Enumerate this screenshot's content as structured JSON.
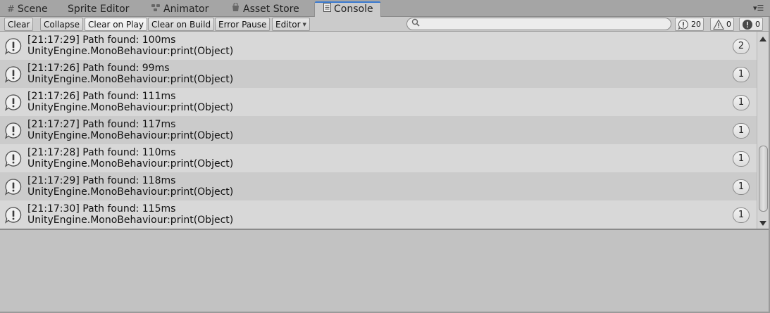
{
  "tabs": [
    {
      "label": "Scene",
      "icon": "grid-icon",
      "glyph": "#"
    },
    {
      "label": "Sprite Editor",
      "icon": "",
      "glyph": ""
    },
    {
      "label": "Animator",
      "icon": "animator-icon",
      "glyph": "⛭"
    },
    {
      "label": "Asset Store",
      "icon": "store-icon",
      "glyph": "🛍"
    },
    {
      "label": "Console",
      "icon": "console-icon",
      "glyph": "▤",
      "active": true
    }
  ],
  "toolbar": {
    "clear_label": "Clear",
    "collapse_label": "Collapse",
    "clear_on_play_label": "Clear on Play",
    "clear_on_build_label": "Clear on Build",
    "error_pause_label": "Error Pause",
    "editor_label": "Editor",
    "search_placeholder": "",
    "search_value": "",
    "log_count": "20",
    "warning_count": "0",
    "error_count": "0"
  },
  "colors": {
    "accent": "#3a7ad0",
    "row_odd": "#d8d8d8",
    "row_even": "#cbcbcb"
  },
  "log_entries": [
    {
      "message": "[21:17:29] Path found: 100ms",
      "source": "UnityEngine.MonoBehaviour:print(Object)",
      "count": "2"
    },
    {
      "message": "[21:17:26] Path found: 99ms",
      "source": "UnityEngine.MonoBehaviour:print(Object)",
      "count": "1"
    },
    {
      "message": "[21:17:26] Path found: 111ms",
      "source": "UnityEngine.MonoBehaviour:print(Object)",
      "count": "1"
    },
    {
      "message": "[21:17:27] Path found: 117ms",
      "source": "UnityEngine.MonoBehaviour:print(Object)",
      "count": "1"
    },
    {
      "message": "[21:17:28] Path found: 110ms",
      "source": "UnityEngine.MonoBehaviour:print(Object)",
      "count": "1"
    },
    {
      "message": "[21:17:29] Path found: 118ms",
      "source": "UnityEngine.MonoBehaviour:print(Object)",
      "count": "1"
    },
    {
      "message": "[21:17:30] Path found: 115ms",
      "source": "UnityEngine.MonoBehaviour:print(Object)",
      "count": "1"
    }
  ]
}
